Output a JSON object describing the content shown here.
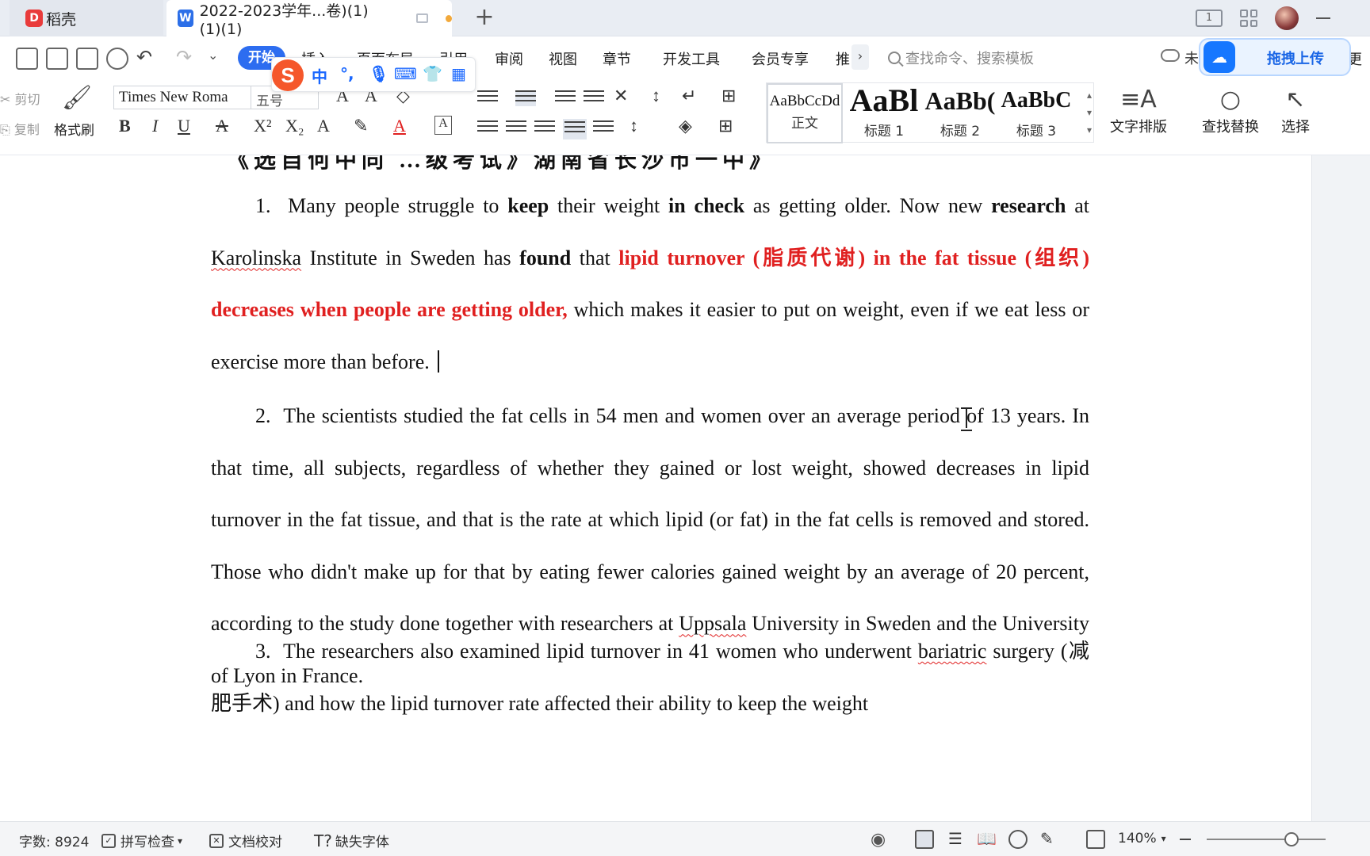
{
  "tabs": {
    "app_name": "稻壳",
    "doc_title": "2022-2023学年...卷)(1)(1)(1)"
  },
  "menu": {
    "items": [
      "开始",
      "插入",
      "页面布局",
      "引用",
      "审阅",
      "视图",
      "章节",
      "开发工具",
      "会员专享",
      "推"
    ],
    "search_placeholder": "查找命令、搜索模板",
    "cloud_text": "未",
    "upload_label": "拖拽上传",
    "overflow_text": "更"
  },
  "ribbon": {
    "cut": "剪切",
    "copy": "复制",
    "format_painter": "格式刷",
    "font_name": "Times New Roma",
    "font_size": "五号",
    "styles": [
      {
        "preview": "AaBbCcDd",
        "name": "正文"
      },
      {
        "preview": "AaBl",
        "name": "标题 1"
      },
      {
        "preview": "AaBb(",
        "name": "标题 2"
      },
      {
        "preview": "AaBbC",
        "name": "标题 3"
      }
    ],
    "text_layout": "文字排版",
    "find_replace": "查找替换",
    "select": "选择",
    "ime_lang": "中"
  },
  "document": {
    "p1": {
      "num": "1.",
      "t1": "Many people struggle to ",
      "b1": "keep",
      "t2": " their weight ",
      "b2": "in check",
      "t3": " as getting older. Now new ",
      "b3": "research",
      "t4": " at ",
      "w1": "Karolinska",
      "t5": " Institute in Sweden has ",
      "b4": "found",
      "t6": " that ",
      "r1": "lipid turnover (脂质代谢) in the fat tissue (组织) decreases when people are getting older,",
      "t7": " which makes it easier to put on weight, even if we eat less or exercise more than before."
    },
    "p2": {
      "num": "2.",
      "text": "The scientists studied the fat cells in 54 men and women over an average period of 13 years. In that time, all subjects, regardless of whether they gained or lost weight, showed decreases in lipid turnover in the fat tissue, and that is the rate at which lipid (or fat) in the fat cells is removed and stored. Those who didn't make up for that by eating fewer calories gained weight by an average of 20 percent, according to the study done together with researchers at ",
      "w1": "Uppsala",
      "text2": " University in Sweden and the University of Lyon in France."
    },
    "p3": {
      "num": "3.",
      "t1": "The researchers also examined lipid turnover in 41 women who underwent ",
      "w1": "bariatric",
      "t2": " surgery (减肥手术) and how the lipid turnover rate affected their ability to keep the weight"
    }
  },
  "statusbar": {
    "word_count": "字数: 8924",
    "spell_check": "拼写检查",
    "doc_proof": "文档校对",
    "missing_font": "缺失字体",
    "zoom": "140%"
  },
  "colors": {
    "accent": "#2d6df0",
    "red_text": "#e02020"
  }
}
